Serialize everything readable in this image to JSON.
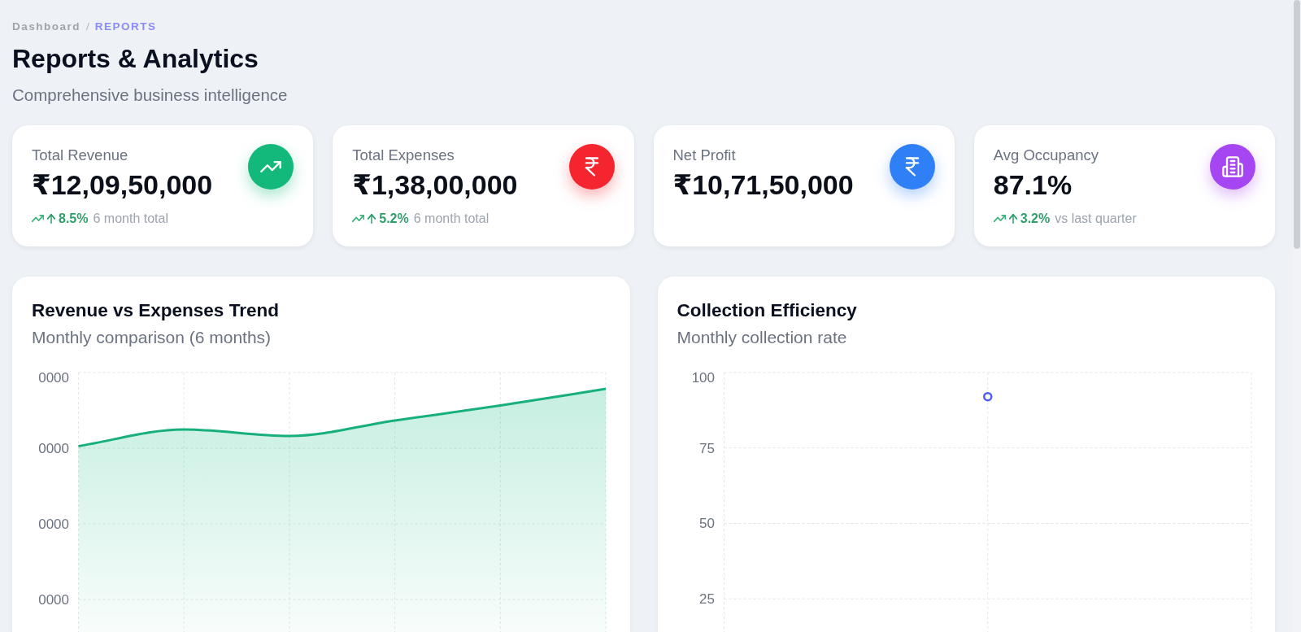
{
  "breadcrumb": {
    "items": [
      {
        "label": "Dashboard",
        "selected": false
      },
      {
        "label": "REPORTS",
        "selected": true
      }
    ],
    "separator": "/"
  },
  "header": {
    "title": "Reports & Analytics",
    "subtitle": "Comprehensive business intelligence"
  },
  "stats": [
    {
      "label": "Total Revenue",
      "value": "₹12,09,50,000",
      "color": "#12b97a",
      "trend": {
        "change": "8.5%",
        "note": "6 month total"
      }
    },
    {
      "label": "Total Expenses",
      "value": "₹1,38,00,000",
      "color": "#f4252f",
      "trend": {
        "change": "5.2%",
        "note": "6 month total"
      }
    },
    {
      "label": "Net Profit",
      "value": "₹10,71,50,000",
      "color": "#2f7ff6"
    },
    {
      "label": "Avg Occupancy",
      "value": "87.1%",
      "color": "#a646f2",
      "trend": {
        "change": "3.2%",
        "note": "vs last quarter"
      }
    }
  ],
  "charts": [
    {
      "title": "Revenue vs Expenses Trend",
      "subtitle": "Monthly comparison (6 months)",
      "y_axis_labels": [
        "0000",
        "0000",
        "0000",
        "0000"
      ]
    },
    {
      "title": "Collection Efficiency",
      "subtitle": "Monthly collection rate",
      "chart_data": {
        "type": "line",
        "grid": true,
        "ylim": [
          14,
          100
        ],
        "yticks": [
          25,
          50,
          75,
          100
        ],
        "series": [
          {
            "color": "#4c5df0",
            "marker": "circle",
            "values": [
              92
            ]
          }
        ]
      }
    }
  ]
}
